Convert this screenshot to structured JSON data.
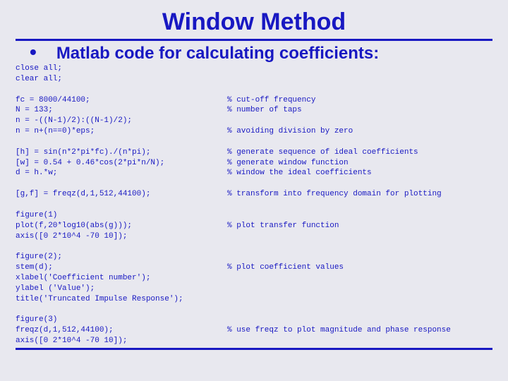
{
  "title": "Window Method",
  "bullet_text": "•",
  "subtitle": "Matlab code for calculating coefficients:",
  "code": [
    {
      "l": "close all;",
      "r": ""
    },
    {
      "l": "clear all;",
      "r": ""
    },
    {
      "l": "",
      "r": ""
    },
    {
      "l": "fc = 8000/44100;",
      "r": "% cut-off frequency"
    },
    {
      "l": "N = 133;",
      "r": "% number of taps"
    },
    {
      "l": "n = -((N-1)/2):((N-1)/2);",
      "r": ""
    },
    {
      "l": "n = n+(n==0)*eps;",
      "r": "% avoiding division by zero"
    },
    {
      "l": "",
      "r": ""
    },
    {
      "l": "[h] = sin(n*2*pi*fc)./(n*pi);",
      "r": "% generate sequence of ideal coefficients"
    },
    {
      "l": "[w] = 0.54 + 0.46*cos(2*pi*n/N);",
      "r": "% generate window function"
    },
    {
      "l": "d = h.*w;",
      "r": "% window the ideal coefficients"
    },
    {
      "l": "",
      "r": ""
    },
    {
      "l": "[g,f] = freqz(d,1,512,44100);",
      "r": "% transform into frequency domain for plotting"
    },
    {
      "l": "",
      "r": ""
    },
    {
      "l": "figure(1)",
      "r": ""
    },
    {
      "l": "plot(f,20*log10(abs(g)));",
      "r": "% plot transfer function"
    },
    {
      "l": "axis([0 2*10^4 -70 10]);",
      "r": ""
    },
    {
      "l": "",
      "r": ""
    },
    {
      "l": "figure(2);",
      "r": ""
    },
    {
      "l": "stem(d);",
      "r": "% plot coefficient values"
    },
    {
      "l": "xlabel('Coefficient number');",
      "r": ""
    },
    {
      "l": "ylabel ('Value');",
      "r": ""
    },
    {
      "l": "title('Truncated Impulse Response');",
      "r": ""
    },
    {
      "l": "",
      "r": ""
    },
    {
      "l": "figure(3)",
      "r": ""
    },
    {
      "l": "freqz(d,1,512,44100);",
      "r": "% use freqz to plot magnitude and phase response"
    },
    {
      "l": "axis([0 2*10^4 -70 10]);",
      "r": ""
    }
  ]
}
